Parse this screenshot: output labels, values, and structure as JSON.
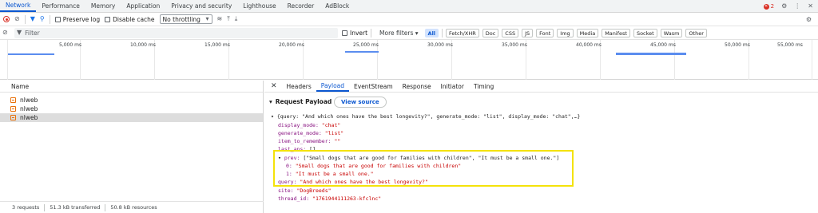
{
  "devtools": {
    "tabs": [
      "Network",
      "Performance",
      "Memory",
      "Application",
      "Privacy and security",
      "Lighthouse",
      "Recorder",
      "AdBlock"
    ],
    "active_tab": "Network",
    "error_count": "2"
  },
  "toolbar": {
    "preserve_log": "Preserve log",
    "disable_cache": "Disable cache",
    "throttling": "No throttling"
  },
  "filter": {
    "placeholder": "Filter",
    "invert": "Invert",
    "more_filters": "More filters",
    "types": [
      "All",
      "Fetch/XHR",
      "Doc",
      "CSS",
      "JS",
      "Font",
      "Img",
      "Media",
      "Manifest",
      "Socket",
      "Wasm",
      "Other"
    ],
    "selected_type": "All"
  },
  "timeline": {
    "ticks": [
      "5,000 ms",
      "10,000 ms",
      "15,000 ms",
      "20,000 ms",
      "25,000 ms",
      "30,000 ms",
      "35,000 ms",
      "40,000 ms",
      "45,000 ms",
      "50,000 ms",
      "55,000 ms"
    ]
  },
  "requests": {
    "column_name": "Name",
    "rows": [
      "nlweb",
      "nlweb",
      "nlweb"
    ],
    "selected_index": 2
  },
  "status": {
    "requests": "3 requests",
    "transferred": "51.3 kB transferred",
    "resources": "50.8 kB resources"
  },
  "detail": {
    "tabs": [
      "Headers",
      "Payload",
      "EventStream",
      "Response",
      "Initiator",
      "Timing"
    ],
    "active_tab": "Payload",
    "section_title": "Request Payload",
    "view_source": "View source"
  },
  "payload": {
    "summary": "{query: \"And which ones have the best longevity?\", generate_mode: \"list\", display_mode: \"chat\",…}",
    "display_mode_key": "display_mode:",
    "display_mode_val": "\"chat\"",
    "generate_mode_key": "generate_mode:",
    "generate_mode_val": "\"list\"",
    "item_to_remember_key": "item_to_remember:",
    "item_to_remember_val": "\"\"",
    "last_ans_key": "last_ans:",
    "last_ans_val": "[]",
    "prev_key": "prev:",
    "prev_val": "[\"Small dogs that are good for families with children\", \"It must be a small one.\"]",
    "prev_0_key": "0:",
    "prev_0_val": "\"Small dogs that are good for families with children\"",
    "prev_1_key": "1:",
    "prev_1_val": "\"It must be a small one.\"",
    "query_key": "query:",
    "query_val": "\"And which ones have the best longevity?\"",
    "site_key": "site:",
    "site_val": "\"DogBreeds\"",
    "thread_id_key": "thread_id:",
    "thread_id_val": "\"1761944111263-kfclnc\""
  },
  "colors": {
    "accent": "#0b57d0",
    "highlight_box": "#f4e20a",
    "json_key": "#881280",
    "json_string": "#c80000"
  }
}
